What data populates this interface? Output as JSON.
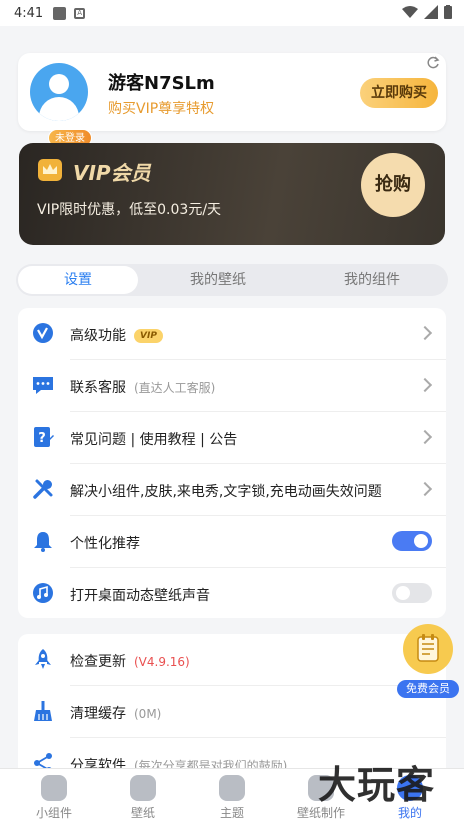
{
  "status_bar": {
    "time": "4:41"
  },
  "profile": {
    "username": "游客N7SLm",
    "login_badge": "未登录",
    "promo": "购买VIP尊享特权",
    "buy_button": "立即购买"
  },
  "vip_banner": {
    "title": "VIP会员",
    "subtitle": "VIP限时优惠，低至0.03元/天",
    "grab_button": "抢购"
  },
  "tabs": [
    {
      "label": "设置",
      "active": true
    },
    {
      "label": "我的壁纸",
      "active": false
    },
    {
      "label": "我的组件",
      "active": false
    }
  ],
  "settings": [
    {
      "label": "高级功能",
      "tag": "VIP"
    },
    {
      "label": "联系客服",
      "note": "(直达人工客服)"
    },
    {
      "label": "常见问题 | 使用教程 | 公告"
    },
    {
      "label": "解决小组件,皮肤,来电秀,文字锁,充电动画失效问题"
    },
    {
      "label": "个性化推荐",
      "toggle": true
    },
    {
      "label": "打开桌面动态壁纸声音",
      "toggle": false
    }
  ],
  "more": [
    {
      "label": "检查更新",
      "note": "(V4.9.16)"
    },
    {
      "label": "清理缓存",
      "note": "(0M)"
    },
    {
      "label": "分享软件",
      "note": "(每次分享都是对我们的鼓励)"
    }
  ],
  "fab": {
    "label": "免费会员"
  },
  "bottom_nav": [
    {
      "label": "小组件"
    },
    {
      "label": "壁纸"
    },
    {
      "label": "主题"
    },
    {
      "label": "壁纸制作"
    },
    {
      "label": "我的",
      "active": true
    }
  ],
  "watermark": "大玩客",
  "colors": {
    "accent": "#3b74f0",
    "vip_gold": "#f6b53c",
    "toggle_on": "#4a7bf3"
  }
}
